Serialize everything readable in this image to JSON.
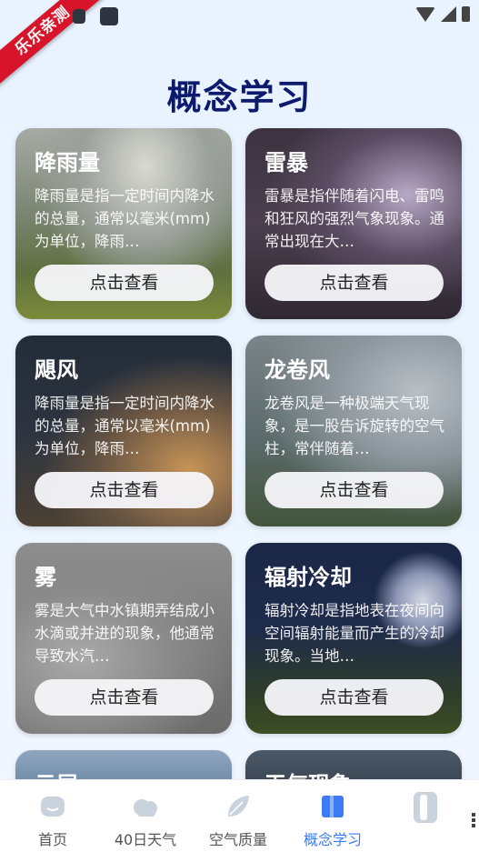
{
  "status_bar": {
    "watermark": "乐乐亲测"
  },
  "page": {
    "title": "概念学习"
  },
  "cards": [
    {
      "title": "降雨量",
      "desc": "降雨量是指一定时间内降水的总量，通常以毫米(mm)为单位，降雨…",
      "button": "点击查看"
    },
    {
      "title": "雷暴",
      "desc": "雷暴是指伴随着闪电、雷鸣和狂风的强烈气象现象。通常出现在大…",
      "button": "点击查看"
    },
    {
      "title": "飓风",
      "desc": "降雨量是指一定时间内降水的总量，通常以毫米(mm)为单位，降雨…",
      "button": "点击查看"
    },
    {
      "title": "龙卷风",
      "desc": "龙卷风是一种极端天气现象，是一股告诉旋转的空气柱，常伴随着…",
      "button": "点击查看"
    },
    {
      "title": "雾",
      "desc": "雾是大气中水镇期弄结成小水滴或并进的现象，他通常导致水汽…",
      "button": "点击查看"
    },
    {
      "title": "辐射冷却",
      "desc": "辐射冷却是指地表在夜间向空间辐射能量而产生的冷却现象。当地…",
      "button": "点击查看"
    },
    {
      "title": "云层"
    },
    {
      "title": "天气现象"
    }
  ],
  "tabbar": {
    "items": [
      {
        "label": "首页",
        "icon": "home-icon"
      },
      {
        "label": "40日天气",
        "icon": "cloud-icon"
      },
      {
        "label": "空气质量",
        "icon": "leaf-icon"
      },
      {
        "label": "概念学习",
        "icon": "book-icon",
        "active": true
      },
      {
        "label": "",
        "icon": "user-icon"
      }
    ],
    "active_color": "#3d7bf5"
  }
}
